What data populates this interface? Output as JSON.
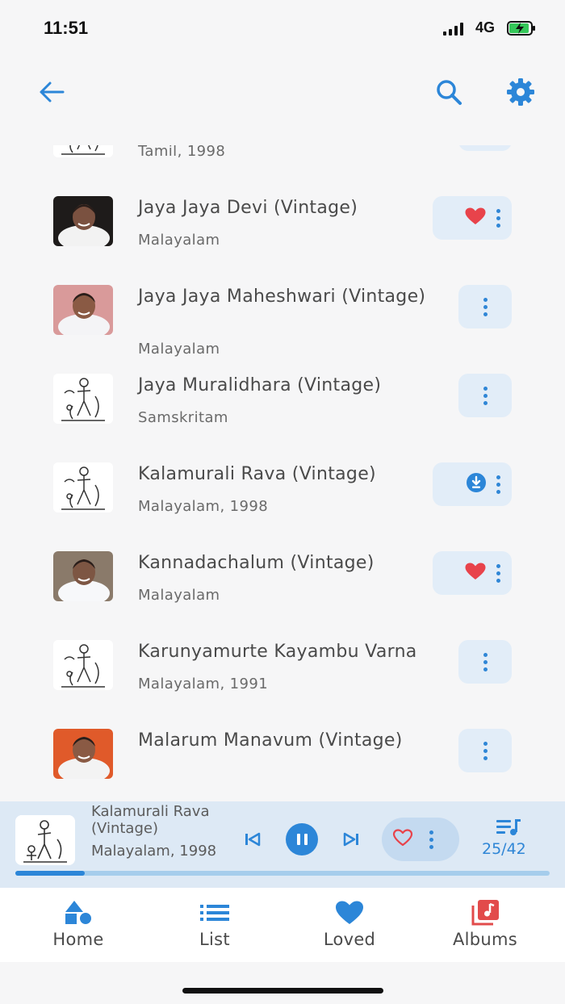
{
  "status": {
    "time": "11:51",
    "network": "4G"
  },
  "header": {
    "back_icon": "arrow-left-icon",
    "search_icon": "search-icon",
    "settings_icon": "gear-icon"
  },
  "colors": {
    "accent": "#2c86d8",
    "heart": "#e8434b",
    "background": "#f6f6f7",
    "albums_icon": "#e24b4b"
  },
  "songs": [
    {
      "title": "",
      "subtitle": "Tamil, 1998",
      "thumb": "line-art",
      "actions": [
        "more"
      ]
    },
    {
      "title": "Jaya Jaya Devi (Vintage)",
      "subtitle": "Malayalam",
      "thumb": "photo-dark",
      "actions": [
        "loved",
        "more"
      ]
    },
    {
      "title": "Jaya Jaya Maheshwari (Vintage)",
      "subtitle": "Malayalam",
      "thumb": "photo-pink",
      "actions": [
        "more"
      ]
    },
    {
      "title": "Jaya Muralidhara (Vintage)",
      "subtitle": "Samskritam",
      "thumb": "line-art",
      "actions": [
        "more"
      ]
    },
    {
      "title": "Kalamurali Rava (Vintage)",
      "subtitle": "Malayalam, 1998",
      "thumb": "line-art",
      "actions": [
        "download",
        "more"
      ]
    },
    {
      "title": "Kannadachalum (Vintage)",
      "subtitle": "Malayalam",
      "thumb": "photo-white",
      "actions": [
        "loved",
        "more"
      ]
    },
    {
      "title": "Karunyamurte Kayambu Varna",
      "subtitle": "Malayalam, 1991",
      "thumb": "line-art",
      "actions": [
        "more"
      ]
    },
    {
      "title": "Malarum Manavum (Vintage)",
      "subtitle": "",
      "thumb": "photo-orange",
      "actions": [
        "more"
      ]
    }
  ],
  "player": {
    "title": "Kalamurali Rava (Vintage)",
    "subtitle": "Malayalam, 1998",
    "queue_position": "25/42",
    "progress": 0.13
  },
  "tabs": [
    {
      "label": "Home",
      "icon": "shapes-icon"
    },
    {
      "label": "List",
      "icon": "list-icon"
    },
    {
      "label": "Loved",
      "icon": "heart-icon"
    },
    {
      "label": "Albums",
      "icon": "albums-icon"
    }
  ]
}
